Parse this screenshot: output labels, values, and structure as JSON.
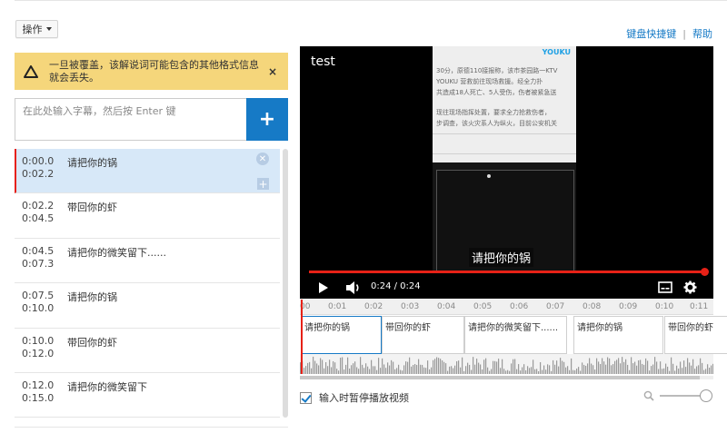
{
  "toolbar": {
    "operations_label": "操作"
  },
  "links": {
    "shortcuts": "键盘快捷键",
    "separator": "|",
    "help": "帮助"
  },
  "warning": {
    "text": "一旦被覆盖，该解说词可能包含的其他格式信息就会丢失。",
    "close": "×"
  },
  "caption_input": {
    "placeholder": "在此处输入字幕，然后按 Enter 键",
    "add": "+"
  },
  "captions": [
    {
      "start": "0:00.0",
      "end": "0:02.2",
      "text": "请把你的锅"
    },
    {
      "start": "0:02.2",
      "end": "0:04.5",
      "text": "带回你的虾"
    },
    {
      "start": "0:04.5",
      "end": "0:07.3",
      "text": "请把你的微笑留下......"
    },
    {
      "start": "0:07.5",
      "end": "0:10.0",
      "text": "请把你的锅"
    },
    {
      "start": "0:10.0",
      "end": "0:12.0",
      "text": "带回你的虾"
    },
    {
      "start": "0:12.0",
      "end": "0:15.0",
      "text": "请把你的微笑留下"
    }
  ],
  "player": {
    "title": "test",
    "time": "0:24 / 0:24",
    "current_caption": "请把你的锅",
    "progress": 1.0,
    "frame": {
      "logo": "YOUKU",
      "lines": [
        "30分，原德110接报称，该市茶园路一KTV",
        "YOUKU 营救前往现场救援。经全力扑",
        "共造成18人死亡、5人受伤，伤者被紧急送",
        "现往现场指挥处置，要求全力抢救伤者，",
        "步调查，该火灾系人为纵火，目前公安机关"
      ]
    }
  },
  "timeline": {
    "ticks": [
      "00",
      "0:01",
      "0:02",
      "0:03",
      "0:04",
      "0:05",
      "0:06",
      "0:07",
      "0:08",
      "0:09",
      "0:10",
      "0:11"
    ],
    "segments": [
      "请把你的锅",
      "带回你的虾",
      "请把你的微笑留下......",
      "请把你的锅",
      "带回你的虾",
      "请把你"
    ]
  },
  "options": {
    "pause_while_typing": "输入时暂停播放视频",
    "pause_checked": true,
    "zoom_level": 1.0
  },
  "colors": {
    "accent": "#167ac6",
    "warning_bg": "#f5d67b",
    "progress": "#e62117",
    "selected_row": "#d7e8f8"
  }
}
